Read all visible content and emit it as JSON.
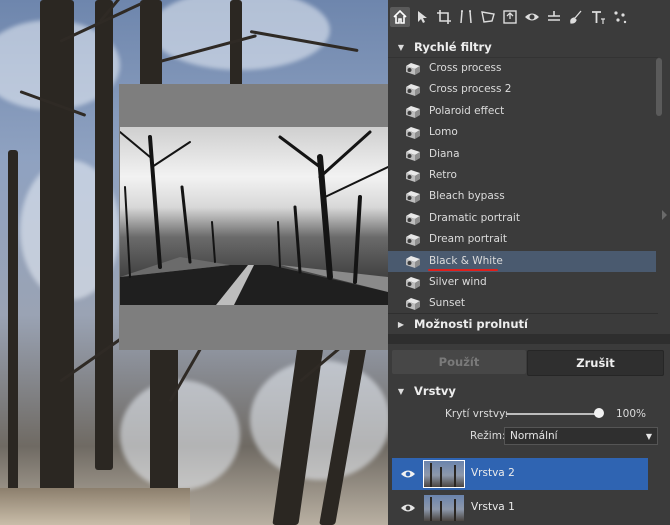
{
  "toolbar": {
    "tools": [
      "home-icon",
      "pointer-icon",
      "crop-icon",
      "straighten-icon",
      "perspective-icon",
      "frame-icon",
      "eye-icon",
      "level-icon",
      "brush-icon",
      "text-icon",
      "effects-icon"
    ]
  },
  "quick_filters": {
    "title": "Rychlé filtry",
    "items": [
      {
        "label": "Cross process"
      },
      {
        "label": "Cross process 2"
      },
      {
        "label": "Polaroid effect"
      },
      {
        "label": "Lomo"
      },
      {
        "label": "Diana"
      },
      {
        "label": "Retro"
      },
      {
        "label": "Bleach bypass"
      },
      {
        "label": "Dramatic portrait"
      },
      {
        "label": "Dream portrait"
      },
      {
        "label": "Black & White"
      },
      {
        "label": "Silver wind"
      },
      {
        "label": "Sunset"
      }
    ],
    "selected": "Black & White",
    "highlight_color": "#4a5a6f",
    "underline_color": "#e0201c"
  },
  "blend_options": {
    "title": "Možnosti prolnutí"
  },
  "actions": {
    "apply_label": "Použít",
    "cancel_label": "Zrušit"
  },
  "layers": {
    "title": "Vrstvy",
    "opacity_label": "Krytí vrstvy:",
    "opacity_value": "100%",
    "opacity_fraction": 1.0,
    "mode_label": "Režim:",
    "mode_value": "Normální",
    "items": [
      {
        "name": "Vrstva 2",
        "selected": true
      },
      {
        "name": "Vrstva 1",
        "selected": false
      }
    ],
    "selected_color": "#2f64b2"
  }
}
